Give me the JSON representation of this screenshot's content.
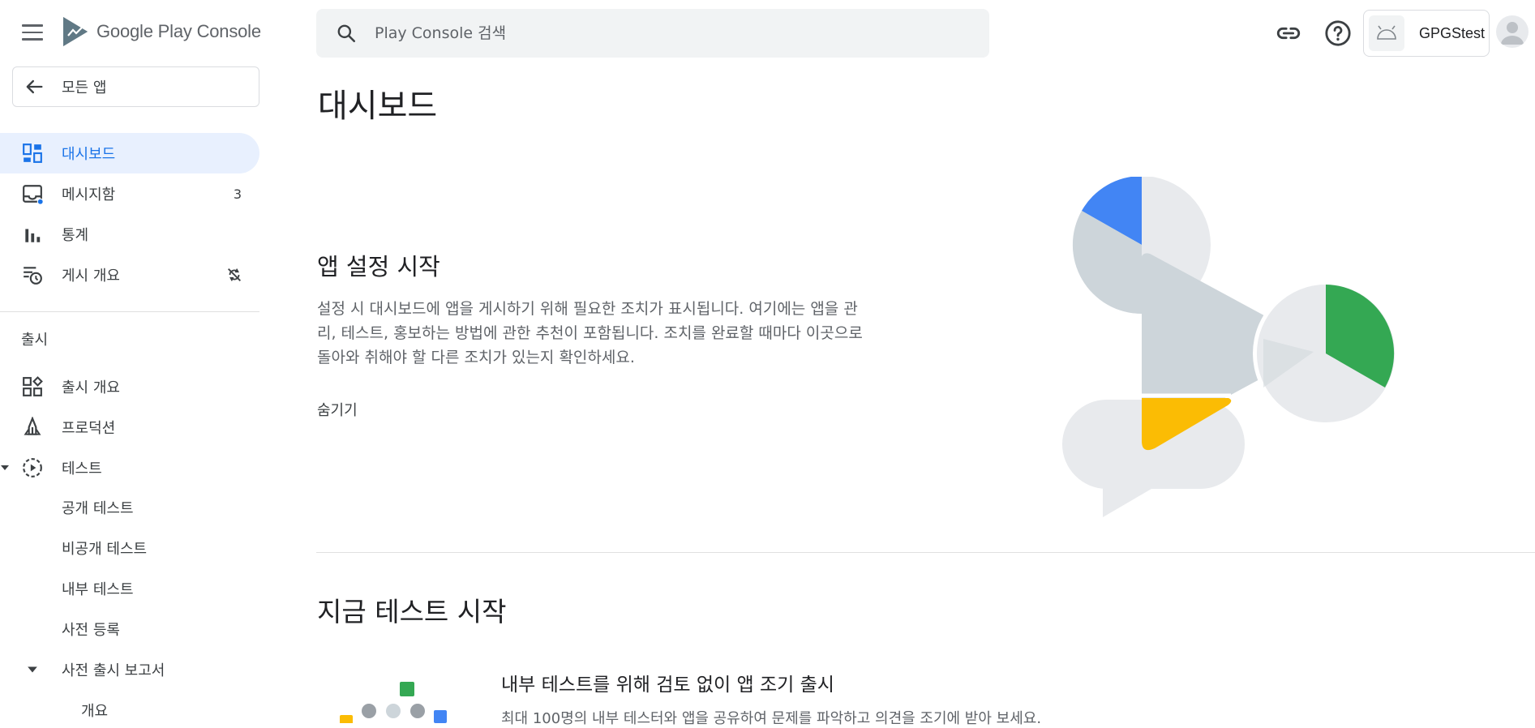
{
  "header": {
    "logo_text": "Google Play Console",
    "search_placeholder": "Play Console 검색",
    "app_name": "GPGStest"
  },
  "sidebar": {
    "back_label": "모든 앱",
    "items": [
      {
        "label": "대시보드",
        "active": true
      },
      {
        "label": "메시지함",
        "badge": "3"
      },
      {
        "label": "통계"
      },
      {
        "label": "게시 개요"
      }
    ],
    "release_section": "출시",
    "release_items": [
      {
        "label": "출시 개요"
      },
      {
        "label": "프로덕션"
      },
      {
        "label": "테스트"
      }
    ],
    "test_sub_items": [
      {
        "label": "공개 테스트"
      },
      {
        "label": "비공개 테스트"
      },
      {
        "label": "내부 테스트"
      },
      {
        "label": "사전 등록"
      }
    ],
    "prelaunch": {
      "label": "사전 출시 보고서"
    },
    "prelaunch_sub": {
      "label": "개요"
    }
  },
  "main": {
    "title": "대시보드",
    "setup": {
      "title": "앱 설정 시작",
      "desc_lines": [
        "설정 시 대시보드에 앱을 게시하기 위해 필요한 조치가 표시됩니다. 여기에는 앱을 관",
        "리, 테스트, 홍보하는 방법에 관한 추천이 포함됩니다. 조치를 완료할 때마다 이곳으로",
        "돌아와 취해야 할 다른 조치가 있는지 확인하세요."
      ],
      "hide_label": "숨기기"
    },
    "test_section": {
      "title": "지금 테스트 시작",
      "subtitle": "내부 테스트를 위해 검토 없이 앱 조기 출시",
      "desc": "최대 100명의 내부 테스터와 앱을 공유하여 문제를 파악하고 의견을 조기에 받아 보세요."
    }
  },
  "colors": {
    "accent": "#1a73e8",
    "active_bg": "#e8f0fe",
    "illus_blue": "#4285f4",
    "illus_green": "#34a853",
    "illus_yellow": "#fbbc04",
    "illus_gray": "#cdd5da",
    "illus_light": "#e8eaed"
  }
}
